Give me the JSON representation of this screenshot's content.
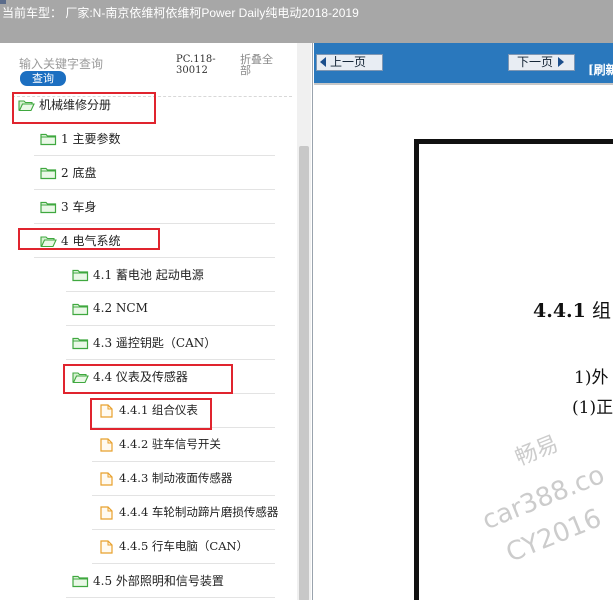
{
  "window": {
    "title": "当前车型：  厂家:N-南京依维柯依维柯Power Daily纯电动2018-2019"
  },
  "search": {
    "placeholder": "输入关键字查询",
    "button_label": "查询",
    "code": "PC.118-30012",
    "collapse_label": "折叠全部"
  },
  "tree": {
    "items": [
      {
        "label": "机械维修分册",
        "icon": "folder-open-icon",
        "highlighted": true
      },
      {
        "label": "1 主要参数",
        "icon": "folder-icon",
        "highlighted": false
      },
      {
        "label": "2 底盘",
        "icon": "folder-icon",
        "highlighted": false
      },
      {
        "label": "3 车身",
        "icon": "folder-icon",
        "highlighted": false
      },
      {
        "label": "4 电气系统",
        "icon": "folder-open-icon",
        "highlighted": true
      },
      {
        "label": "4.1 蓄电池 起动电源",
        "icon": "folder-icon",
        "highlighted": false
      },
      {
        "label": "4.2 NCM",
        "icon": "folder-icon",
        "highlighted": false
      },
      {
        "label": "4.3 遥控钥匙（CAN）",
        "icon": "folder-icon",
        "highlighted": false
      },
      {
        "label": "4.4 仪表及传感器",
        "icon": "folder-open-icon",
        "highlighted": true
      },
      {
        "label": "4.4.1 组合仪表",
        "icon": "document-icon",
        "highlighted": true,
        "selected": true
      },
      {
        "label": "4.4.2 驻车信号开关",
        "icon": "document-icon",
        "highlighted": false
      },
      {
        "label": "4.4.3 制动液面传感器",
        "icon": "document-icon",
        "highlighted": false
      },
      {
        "label": "4.4.4 车轮制动蹄片磨损传感器",
        "icon": "document-icon",
        "highlighted": false
      },
      {
        "label": "4.4.5 行车电脑（CAN）",
        "icon": "document-icon",
        "highlighted": false
      },
      {
        "label": "4.5 外部照明和信号装置",
        "icon": "folder-icon",
        "highlighted": false
      }
    ]
  },
  "viewer": {
    "prev_label": "上一页",
    "next_label": "下一页",
    "refresh_label": "[刷新",
    "heading_number": "4.4.1",
    "heading_text": "组",
    "line1": "1)外",
    "line2": "(1)正",
    "watermark": [
      "畅易",
      "car388.co",
      "CY2016"
    ]
  },
  "colors": {
    "toolbar": "#2a78bd",
    "highlight_box": "#e0242e",
    "folder": "#3fa83f",
    "document": "#e8a02c",
    "title_bar": "#a7a7a7"
  }
}
